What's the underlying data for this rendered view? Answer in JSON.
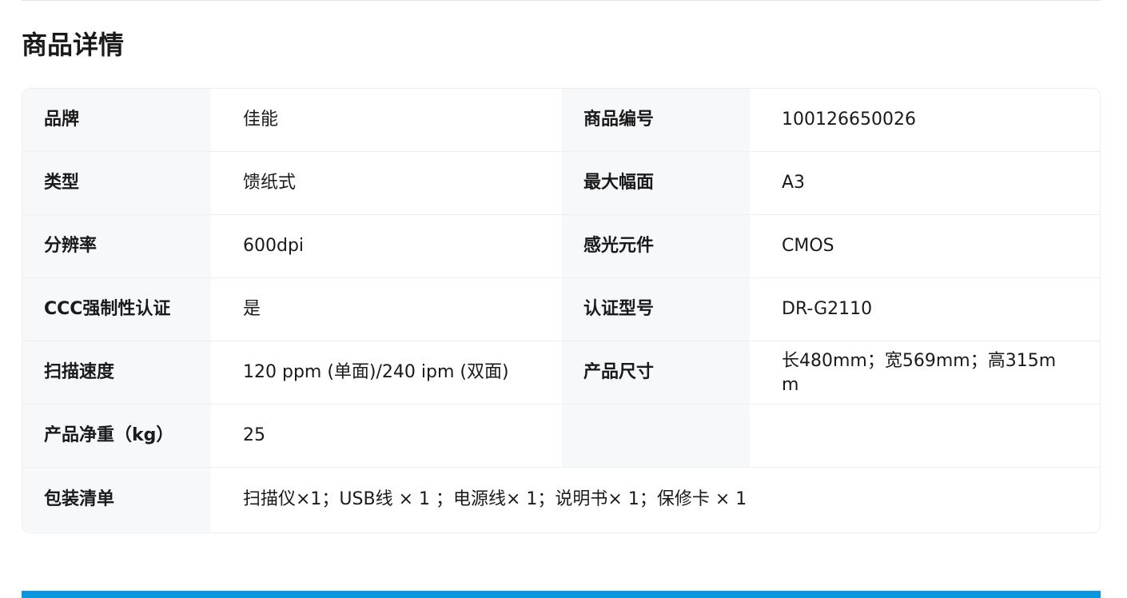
{
  "section": {
    "title": "商品详情"
  },
  "specs": {
    "rows": [
      {
        "label1": "品牌",
        "value1": "佳能",
        "label2": "商品编号",
        "value2": "100126650026"
      },
      {
        "label1": "类型",
        "value1": "馈纸式",
        "label2": "最大幅面",
        "value2": "A3"
      },
      {
        "label1": "分辨率",
        "value1": "600dpi",
        "label2": "感光元件",
        "value2": "CMOS"
      },
      {
        "label1": "CCC强制性认证",
        "value1": "是",
        "label2": "认证型号",
        "value2": "DR-G2110"
      },
      {
        "label1": "扫描速度",
        "value1": "120 ppm (单面)/240 ipm (双面)",
        "label2": "产品尺寸",
        "value2": "长480mm；宽569mm；高315mm"
      },
      {
        "label1": "产品净重（kg）",
        "value1": "25",
        "label2": "",
        "value2": ""
      }
    ],
    "package": {
      "label": "包装清单",
      "value": "扫描仪×1；USB线 × 1 ；电源线× 1；说明书× 1；保修卡 × 1"
    }
  },
  "colors": {
    "accent_bar": "#0b97df",
    "label_bg": "#f7f8fa",
    "border": "#eceef2"
  }
}
